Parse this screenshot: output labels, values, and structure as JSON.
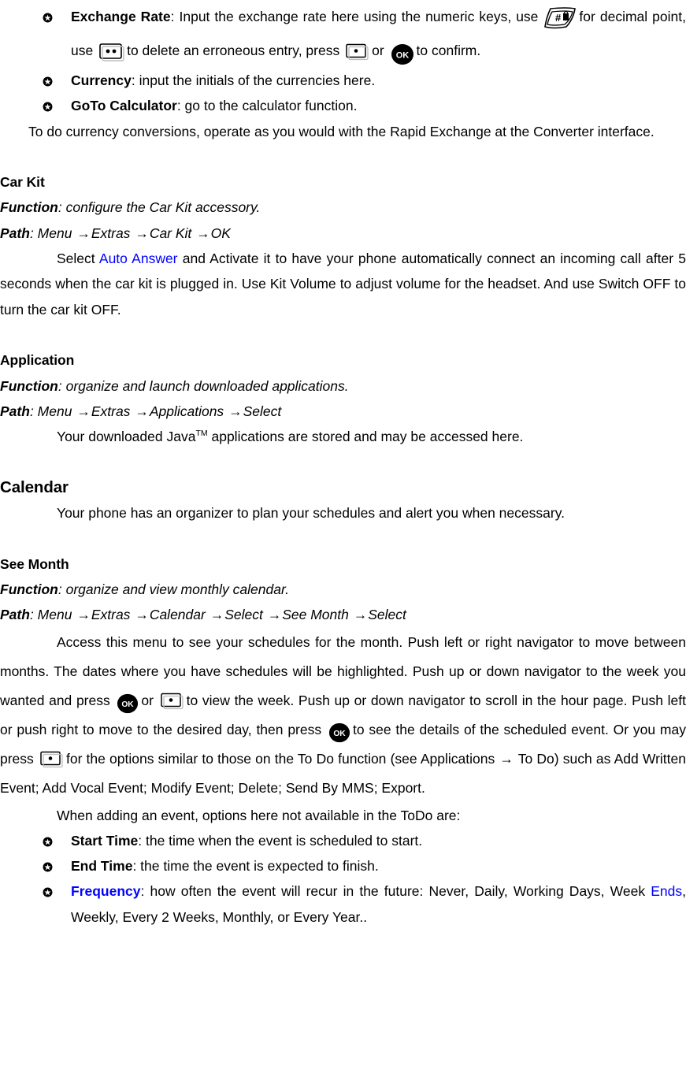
{
  "document": {
    "blocks": {
      "bullet_exchange_rate": {
        "term": "Exchange Rate",
        "text_1": ": Input the exchange rate here using the numeric keys, use",
        "text_2": "for decimal point, use",
        "text_3": "to delete an erroneous entry, press",
        "text_4": "or",
        "text_5": "to confirm."
      },
      "bullet_currency": {
        "term": "Currency",
        "text": ": input the initials of the currencies here."
      },
      "bullet_goto_calculator": {
        "term": "GoTo Calculator",
        "text": ": go to the calculator function."
      },
      "para_conversions": "To do currency conversions, operate as you would with the Rapid Exchange at the Converter interface.",
      "car_kit": {
        "heading": "Car Kit",
        "function_label": "Function",
        "function_text": ": configure the Car Kit accessory.",
        "path_label": "Path",
        "path_items": [
          "Menu",
          "Extras",
          "Car Kit",
          "OK"
        ],
        "body_1": "Select",
        "body_link": "Auto Answer",
        "body_2": "and Activate it to have your phone automatically connect an incoming call after 5 seconds when the car kit is plugged in. Use Kit Volume to adjust volume for the headset. And use Switch OFF to turn the car kit OFF."
      },
      "application": {
        "heading": "Application",
        "function_label": "Function",
        "function_text": ": organize and launch downloaded applications.",
        "path_label": "Path",
        "path_items": [
          "Menu",
          "Extras",
          "Applications",
          "Select"
        ],
        "body_1": "Your downloaded Java",
        "body_tm": "TM",
        "body_2": "applications are stored and may be accessed here."
      },
      "calendar": {
        "heading": "Calendar",
        "body": "Your phone has an organizer to plan your schedules and alert you when necessary."
      },
      "see_month": {
        "heading": "See Month",
        "function_label": "Function",
        "function_text": ": organize and view monthly calendar.",
        "path_label": "Path",
        "path_items": [
          "Menu",
          "Extras",
          "Calendar",
          "Select",
          "See Month",
          "Select"
        ],
        "body_1": "Access this menu to see your schedules for the month. Push left or right navigator to move between months. The dates where you have schedules will be highlighted. Push up or down navigator to the week you wanted and press",
        "body_2": "or",
        "body_3": "to view the week. Push up or down navigator to scroll in the hour page. Push left or push right to move to the desired day, then press",
        "body_4": "to see the details of the scheduled event.  Or you may press",
        "body_5": "for the options similar to those on the To Do function (see Applications",
        "body_6": "To Do) such as Add Written Event; Add Vocal Event; Modify Event; Delete; Send By MMS; Export.",
        "body_7": "When adding an event, options here not available in the ToDo are:"
      },
      "bullet_start_time": {
        "term": "Start Time",
        "text": ": the time when the event is scheduled to start."
      },
      "bullet_end_time": {
        "term": "End Time",
        "text": ": the time the event is expected to finish."
      },
      "bullet_frequency": {
        "term": "Frequency",
        "text_1": ": how often the event will recur in the future: Never, Daily, Working Days, Week",
        "link": "Ends",
        "text_2": ", Weekly, Every 2 Weeks, Monthly, or Every Year.."
      }
    },
    "glyphs": {
      "arrow": "→",
      "hash_key": "hash-key-icon",
      "clear_key": "clear-key-icon",
      "soft_key": "soft-key-icon",
      "ok_key": "ok-key-icon",
      "ok_label": "OK",
      "hash_label": "#",
      "bullet": "clover-bullet-icon"
    },
    "colors": {
      "text": "#000000",
      "link": "#0000ff",
      "background": "#ffffff"
    }
  }
}
